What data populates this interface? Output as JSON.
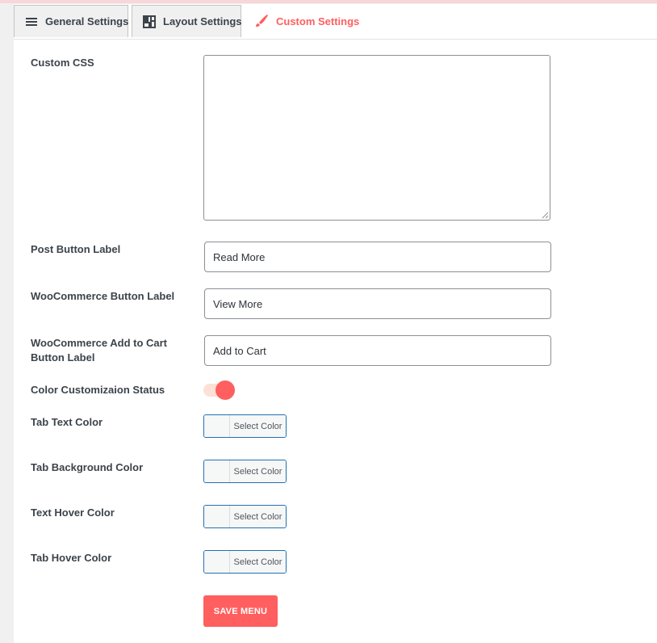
{
  "tabs": [
    {
      "label": "General Settings",
      "icon": "hamburger-menu-icon"
    },
    {
      "label": "Layout Settings",
      "icon": "layout-grid-icon"
    },
    {
      "label": "Custom Settings",
      "icon": "paint-brush-icon",
      "active": true
    }
  ],
  "form": {
    "custom_css": {
      "label": "Custom CSS",
      "value": ""
    },
    "post_button": {
      "label": "Post Button Label",
      "value": "Read More"
    },
    "woo_button": {
      "label": "WooCommerce Button Label",
      "value": "View More"
    },
    "woo_cart_button": {
      "label_line1": "WooCommerce Add to Cart",
      "label_line2": "Button Label",
      "value": "Add to Cart"
    },
    "color_status": {
      "label": "Color Customizaion Status",
      "enabled": true
    },
    "tab_text_color": {
      "label": "Tab Text Color",
      "button": "Select Color"
    },
    "tab_bg_color": {
      "label": "Tab Background Color",
      "button": "Select Color"
    },
    "text_hover_color": {
      "label": "Text Hover Color",
      "button": "Select Color"
    },
    "tab_hover_color": {
      "label": "Tab Hover Color",
      "button": "Select Color"
    }
  },
  "save_label": "SAVE MENU",
  "colors": {
    "accent": "#ff5f5f",
    "toggle_track": "#fde0d6",
    "picker_border": "#2271b1"
  }
}
